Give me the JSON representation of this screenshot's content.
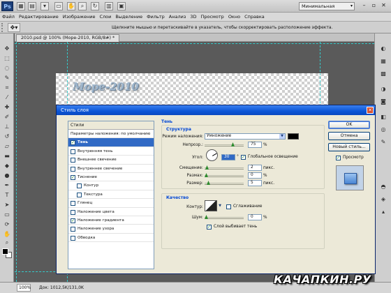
{
  "app": {
    "logo": "Ps",
    "workspace": "Минимальная"
  },
  "menu": [
    "Файл",
    "Редактирование",
    "Изображение",
    "Слои",
    "Выделение",
    "Фильтр",
    "Анализ",
    "3D",
    "Просмотр",
    "Окно",
    "Справка"
  ],
  "options_bar": {
    "hint": "Щелкните мышью и перетаскивайте в указатель, чтобы скорректировать расположение эффекта."
  },
  "document": {
    "tab_title": "2010.psd @ 100% (Море-2010, RGB/8#) *",
    "canvas_text": "Море-2010"
  },
  "status": {
    "zoom": "100%",
    "doc_info": "Док: 1012,5K/131,0K"
  },
  "dialog": {
    "title": "Стиль слоя",
    "close": "✕",
    "styles_header": "Стили",
    "style_items": [
      {
        "label": "Параметры наложения: по умолчанию",
        "checked": null,
        "level": 0,
        "selected": false
      },
      {
        "label": "Тень",
        "checked": true,
        "level": 0,
        "selected": true
      },
      {
        "label": "Внутренняя тень",
        "checked": false,
        "level": 0,
        "selected": false
      },
      {
        "label": "Внешнее свечение",
        "checked": false,
        "level": 0,
        "selected": false
      },
      {
        "label": "Внутреннее свечение",
        "checked": false,
        "level": 0,
        "selected": false
      },
      {
        "label": "Тиснение",
        "checked": true,
        "level": 0,
        "selected": false
      },
      {
        "label": "Контур",
        "checked": false,
        "level": 1,
        "selected": false
      },
      {
        "label": "Текстура",
        "checked": false,
        "level": 1,
        "selected": false
      },
      {
        "label": "Глянец",
        "checked": false,
        "level": 0,
        "selected": false
      },
      {
        "label": "Наложение цвета",
        "checked": false,
        "level": 0,
        "selected": false
      },
      {
        "label": "Наложение градиента",
        "checked": true,
        "level": 0,
        "selected": false
      },
      {
        "label": "Наложение узора",
        "checked": false,
        "level": 0,
        "selected": false
      },
      {
        "label": "Обводка",
        "checked": false,
        "level": 0,
        "selected": false
      }
    ],
    "shadow": {
      "section_title": "Тень",
      "structure_title": "Структура",
      "blend_mode_label": "Режим наложения:",
      "blend_mode_value": "Умножение",
      "opacity_label": "Непрозр.:",
      "opacity_value": "75",
      "opacity_unit": "%",
      "opacity_level": 0.75,
      "angle_label": "Угол:",
      "angle_value": "30",
      "angle_unit": "°",
      "global_light_label": "Глобальное освещение",
      "global_light_checked": true,
      "distance_label": "Смещение:",
      "distance_value": "2",
      "distance_unit": "пикс.",
      "spread_label": "Размах:",
      "spread_value": "0",
      "spread_unit": "%",
      "size_label": "Размер:",
      "size_value": "5",
      "size_unit": "пикс.",
      "quality_title": "Качество",
      "contour_label": "Контур:",
      "antialias_label": "Сглаживание",
      "antialias_checked": false,
      "noise_label": "Шум:",
      "noise_value": "0",
      "noise_unit": "%",
      "knockout_label": "Слой выбивает тень",
      "knockout_checked": true,
      "shadow_color": "#000000"
    },
    "buttons": {
      "ok": "OK",
      "cancel": "Отмена",
      "new_style": "Новый стиль...",
      "preview_label": "Просмотр",
      "preview_checked": true
    }
  },
  "watermark": "КАЧАПКИН.РУ"
}
